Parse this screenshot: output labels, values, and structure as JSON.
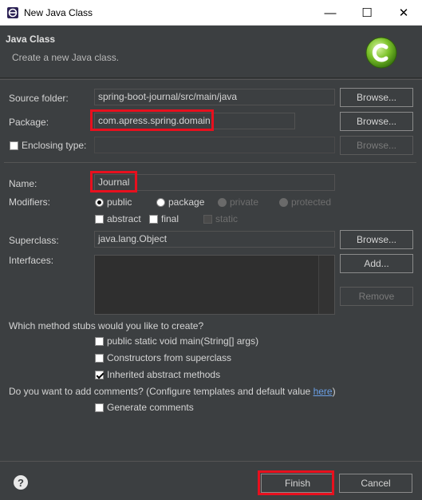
{
  "window": {
    "title": "New Java Class",
    "controls": [
      "—",
      "☐",
      "✕"
    ]
  },
  "header": {
    "title": "Java Class",
    "description": "Create a new Java class."
  },
  "source_folder": {
    "label": "Source folder:",
    "value": "spring-boot-journal/src/main/java",
    "browse_label": "Browse..."
  },
  "package": {
    "label": "Package:",
    "value": "com.apress.spring.domain",
    "browse_label": "Browse..."
  },
  "enclosing_type": {
    "label": "Enclosing type:",
    "value": "",
    "browse_label": "Browse..."
  },
  "name": {
    "label": "Name:",
    "value": "Journal"
  },
  "modifiers": {
    "label": "Modifiers:",
    "access": [
      {
        "label": "public",
        "selected": true,
        "enabled": true
      },
      {
        "label": "package",
        "selected": false,
        "enabled": true
      },
      {
        "label": "private",
        "selected": false,
        "enabled": false
      },
      {
        "label": "protected",
        "selected": false,
        "enabled": false
      }
    ],
    "flags": [
      {
        "label": "abstract",
        "checked": false,
        "enabled": true
      },
      {
        "label": "final",
        "checked": false,
        "enabled": true
      },
      {
        "label": "static",
        "checked": false,
        "enabled": false
      }
    ]
  },
  "superclass": {
    "label": "Superclass:",
    "value": "java.lang.Object",
    "browse_label": "Browse..."
  },
  "interfaces": {
    "label": "Interfaces:",
    "add_label": "Add...",
    "remove_label": "Remove"
  },
  "stubs": {
    "question": "Which method stubs would you like to create?",
    "options": [
      {
        "label": "public static void main(String[] args)",
        "checked": false
      },
      {
        "label": "Constructors from superclass",
        "checked": false
      },
      {
        "label": "Inherited abstract methods",
        "checked": true
      }
    ]
  },
  "comments": {
    "question_prefix": "Do you want to add comments? (Configure templates and default value ",
    "link": "here",
    "question_suffix": ")",
    "generate_label": "Generate comments",
    "generate_checked": false
  },
  "footer": {
    "help_symbol": "?",
    "finish_label": "Finish",
    "cancel_label": "Cancel"
  },
  "colors": {
    "highlight": "#e8101e",
    "background": "#3c3f41",
    "link": "#6a9fe5"
  }
}
